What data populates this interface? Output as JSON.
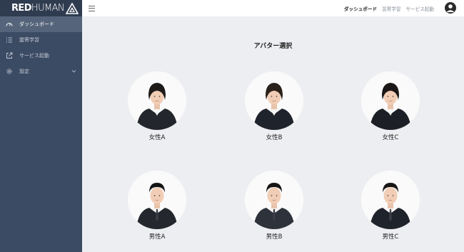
{
  "brand": {
    "text_bold": "RED",
    "text_light": "HUMAN"
  },
  "sidebar": {
    "items": [
      {
        "label": "ダッシュボード",
        "icon": "speedometer-icon",
        "active": true
      },
      {
        "label": "震寄学習",
        "icon": "list-icon",
        "active": false
      },
      {
        "label": "サービス起動",
        "icon": "external-link-icon",
        "active": false
      },
      {
        "label": "設定",
        "icon": "gear-icon",
        "active": false,
        "has_submenu": true
      }
    ]
  },
  "header": {
    "links": [
      {
        "label": "ダッシュボード",
        "current": true
      },
      {
        "label": "習寄学習",
        "current": false
      },
      {
        "label": "サービス起動",
        "current": false
      }
    ]
  },
  "main": {
    "title": "アバター選択",
    "avatars": [
      {
        "label": "女性A",
        "gender": "female",
        "suit": "#23262d",
        "hair": "#1d1a18"
      },
      {
        "label": "女性B",
        "gender": "female",
        "suit": "#1f232b",
        "hair": "#2a211b"
      },
      {
        "label": "女性C",
        "gender": "female",
        "suit": "#1c1f25",
        "hair": "#1a1716"
      },
      {
        "label": "男性A",
        "gender": "male",
        "suit": "#24272e",
        "hair": "#151414"
      },
      {
        "label": "男性B",
        "gender": "male",
        "suit": "#2e323b",
        "hair": "#161514"
      },
      {
        "label": "男性C",
        "gender": "male",
        "suit": "#1f232b",
        "hair": "#181716"
      }
    ]
  },
  "colors": {
    "sidebar_bg": "#3c4b64",
    "sidebar_active": "#56647b",
    "content_bg": "#eceef1"
  }
}
